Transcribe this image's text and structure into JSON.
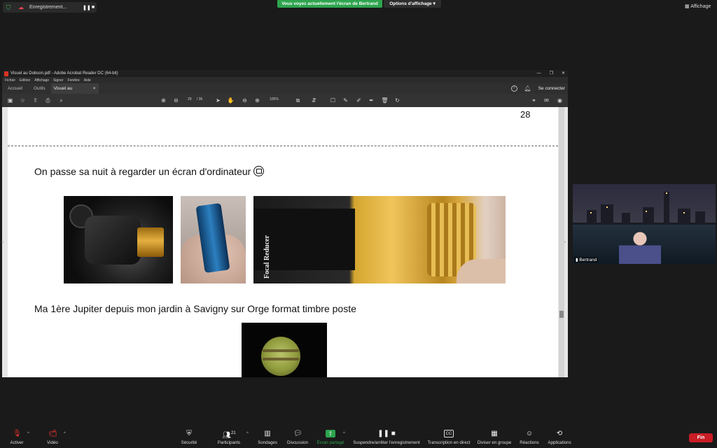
{
  "zoom": {
    "recording_label": "Enregistrement...",
    "share_banner": "Vous voyez actuellement l'écran de Bertrand",
    "view_options": "Options d'affichage",
    "display_label": "Affichage",
    "participant_name": "Bertrand",
    "participants_count": "21",
    "end_label": "Fin",
    "toolbar": {
      "mute": "Activer",
      "video": "Vidéo",
      "security": "Sécurité",
      "participants": "Participants",
      "polls": "Sondages",
      "chat": "Discussion",
      "share": "Écran partagé",
      "record": "Suspendre/arrêter l'enregistrement",
      "transcript": "Transcription en direct",
      "breakout": "Diviser en groupe",
      "reactions": "Réactions",
      "apps": "Applications"
    },
    "colors": {
      "share_green": "#2da44e",
      "end_red": "#c81d25"
    }
  },
  "acrobat": {
    "window_title": "Visuel au Dobson.pdf - Adobe Acrobat Reader DC (64-bit)",
    "menu": [
      "Fichier",
      "Edition",
      "Affichage",
      "Signer",
      "Fenêtre",
      "Aide"
    ],
    "tabs": {
      "home": "Accueil",
      "tools": "Outils",
      "doc": "Visuel au Dobson.p...",
      "doc_close": "×"
    },
    "connect": "Se connecter",
    "page_current": "29",
    "page_total": "/ 36",
    "zoom": "105%"
  },
  "page": {
    "number": "28",
    "line1": "On passe sa nuit à regarder un écran d'ordinateur",
    "line2": "Ma 1ère Jupiter depuis mon jardin à Savigny sur Orge format timbre poste",
    "reducer_label": "Focal Reducer"
  }
}
